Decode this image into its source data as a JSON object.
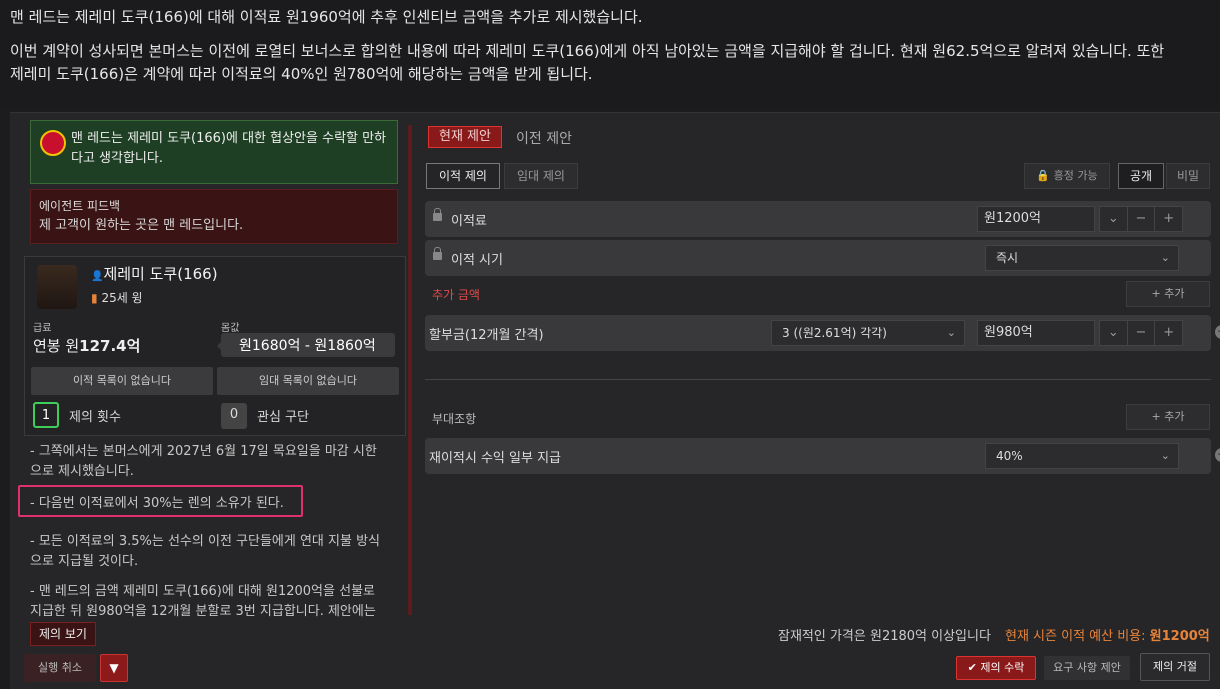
{
  "top": {
    "line1": "맨 레드는 제레미 도쿠(166)에 대해 이적료 원1960억에 추후 인센티브 금액을 추가로 제시했습니다.",
    "line2a": "이번 계약이 성사되면 본머스는 이전에 로열티 보너스로 합의한 내용에 따라 제레미 도쿠(166)에게 아직 남아있는 금액을 지급해야 할 겁니다. 현재 원62.5억으로 알려져 있습니다. 또한",
    "line2b": "제레미 도쿠(166)은 계약에 따라 이적료의 40%인 원780억에 해당하는 금액을 받게 됩니다."
  },
  "club_message": "맨 레드는 제레미 도쿠(166)에 대한 협상안을 수락할 만하다고 생각합니다.",
  "agent_feedback": {
    "title": "에이전트 피드백",
    "text": "제 고객이 원하는 곳은 맨 레드입니다."
  },
  "player": {
    "name": "제레미 도쿠(166)",
    "age_pos": "25세 윙",
    "wage_label": "급료",
    "wage_prefix": "연봉 원",
    "wage_value": "127.4억",
    "value_label": "몸값",
    "value_range": "원1680억 - 원1860억",
    "transfer_list": "이적 목록이 없습니다",
    "loan_list": "임대 목록이 없습니다",
    "offers_count": "1",
    "offers_label": "제의 횟수",
    "interested_count": "0",
    "interested_label": "관심 구단"
  },
  "notes": [
    "- 그쪽에서는 본머스에게 2027년 6월 17일 목요일을 마감 시한으로 제시했습니다.",
    "- 다음번 이적료에서 30%는 렌의 소유가 된다.",
    "- 모든 이적료의 3.5%는 선수의 이전 구단들에게 연대 지불 방식으로 지급될 것이다.",
    "- 맨 레드의 금액 제레미 도쿠(166)에 대해 원1200억을 선불로 지급한 뒤 원980억을 12개월 분할로 3번 지급합니다. 제안에는"
  ],
  "view_offer": "제의 보기",
  "undo": "실행 취소",
  "tabs": {
    "current": "현재 제안",
    "previous": "이전 제안"
  },
  "subtabs": {
    "transfer": "이적 제의",
    "loan": "임대 제의"
  },
  "visibility": {
    "negotiable": "흥정 가능",
    "public": "공개",
    "private": "비밀"
  },
  "fee": {
    "label": "이적료",
    "value": "원1200억"
  },
  "timing": {
    "label": "이적 시기",
    "value": "즉시"
  },
  "extra_amount_label": "추가 금액",
  "add_label": "+ 추가",
  "installments": {
    "label": "할부금(12개월 간격)",
    "count": "3 ((원2.61억) 각각)",
    "value": "원980억"
  },
  "clauses_label": "부대조항",
  "sell_on": {
    "label": "재이적시 수익 일부 지급",
    "value": "40%"
  },
  "footer": {
    "potential": "잠재적인 가격은 원2180억 이상입니다",
    "budget_prefix": "현재 시즌 이적 예산 비용: ",
    "budget_value": "원1200억",
    "accept": "제의 수락",
    "demand": "요구 사항 제안",
    "reject": "제의 거절"
  },
  "colors": {
    "accent": "#8a1919",
    "positive": "#3ecf5a",
    "budget": "#e8833a"
  }
}
